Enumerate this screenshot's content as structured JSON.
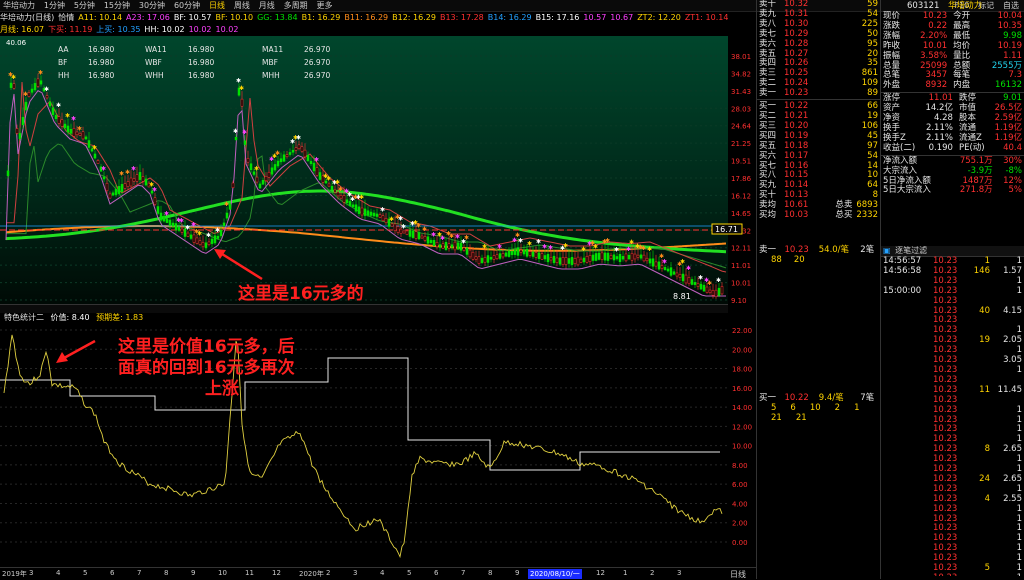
{
  "menu": {
    "items": [
      "华培动力",
      "1分钟",
      "5分钟",
      "15分钟",
      "30分钟",
      "60分钟",
      "日线",
      "周线",
      "月线",
      "多周期",
      "更多"
    ],
    "active": "日线",
    "right_items": [
      "F10",
      "标记",
      "自选"
    ]
  },
  "header_row1": [
    {
      "label": "华培动力(日线)",
      "color": "#e6e6e6"
    },
    {
      "label": "恰情",
      "color": "#e6e6e6"
    },
    {
      "label": "A11: 10.14",
      "color": "#ffd400"
    },
    {
      "label": "A23: 17.06",
      "color": "#ff40ff"
    },
    {
      "label": "BF: 10.57",
      "color": "#ffffff"
    },
    {
      "label": "BF: 10.10",
      "color": "#ffd400"
    },
    {
      "label": "GG: 13.84",
      "color": "#00e000"
    },
    {
      "label": "B1: 16.29",
      "color": "#ffd400"
    },
    {
      "label": "B11: 16.29",
      "color": "#ff8c1a"
    },
    {
      "label": "B12: 16.29",
      "color": "#ffd400"
    },
    {
      "label": "B13: 17.28",
      "color": "#ff3030"
    },
    {
      "label": "B14: 16.29",
      "color": "#22a0ff"
    },
    {
      "label": "B15: 17.16",
      "color": "#ffffff"
    },
    {
      "label": "10.57",
      "color": "#ff40ff"
    },
    {
      "label": "10.67",
      "color": "#ff40ff"
    },
    {
      "label": "ZT2: 12.20",
      "color": "#ffd400"
    },
    {
      "label": "ZT1: 10.14",
      "color": "#ff3030"
    }
  ],
  "header_row2": [
    {
      "label": "月线: 16.07",
      "color": "#ffd400"
    },
    {
      "label": "下买: 11.19",
      "color": "#ff3030"
    },
    {
      "label": "上买: 10.35",
      "color": "#22a0ff"
    },
    {
      "label": "HH: 10.02",
      "color": "#ffffff"
    },
    {
      "label": "10.02",
      "color": "#ff40ff"
    },
    {
      "label": "10.02",
      "color": "#ff40ff"
    }
  ],
  "legend_box": {
    "rows": [
      [
        {
          "k": "AA",
          "v": "16.980"
        },
        {
          "k": "WA11",
          "v": "16.980"
        },
        {
          "k": "MA11",
          "v": "26.970"
        }
      ],
      [
        {
          "k": "BF",
          "v": "16.980"
        },
        {
          "k": "WBF",
          "v": "16.980"
        },
        {
          "k": "MBF",
          "v": "26.970"
        }
      ],
      [
        {
          "k": "HH",
          "v": "16.980"
        },
        {
          "k": "WHH",
          "v": "16.980"
        },
        {
          "k": "MHH",
          "v": "26.970"
        }
      ]
    ]
  },
  "main_price_labels": [
    "38.01",
    "34.82",
    "31.43",
    "28.03",
    "24.64",
    "21.25",
    "19.51",
    "17.86",
    "16.12",
    "14.65",
    "13.32",
    "12.11",
    "11.01",
    "10.01",
    "9.10"
  ],
  "main_extra_labels": {
    "high": "40.06",
    "low": "8.81",
    "current": "16.71"
  },
  "ind_header": {
    "name": "特色统计二",
    "value_label": "价值: 8.40",
    "diff_label": "预期差: 1.83"
  },
  "ind_labels": [
    "22.00",
    "20.00",
    "18.00",
    "16.00",
    "14.00",
    "12.00",
    "10.00",
    "8.00",
    "6.00",
    "4.00",
    "2.00",
    "0.00"
  ],
  "annotations": {
    "a1": "这里是16元多的",
    "a2_line1": "这里是价值16元多，后",
    "a2_line2": "面真的回到16元多再次",
    "a2_line3": "上涨"
  },
  "bottom_axis": {
    "labels": [
      "2019年",
      "3",
      "4",
      "5",
      "6",
      "7",
      "8",
      "9",
      "10",
      "11",
      "12",
      "2020年",
      "2",
      "3",
      "4",
      "5",
      "6",
      "7",
      "8",
      "9",
      "10",
      "11",
      "12",
      "1",
      "2",
      "3"
    ],
    "date_box": "2020/08/10/一",
    "period": "日线"
  },
  "orderbook_sell": [
    {
      "name": "卖十",
      "price": "10.32",
      "vol": "59"
    },
    {
      "name": "卖九",
      "price": "10.31",
      "vol": "54"
    },
    {
      "name": "卖八",
      "price": "10.30",
      "vol": "225"
    },
    {
      "name": "卖七",
      "price": "10.29",
      "vol": "50"
    },
    {
      "name": "卖六",
      "price": "10.28",
      "vol": "95"
    },
    {
      "name": "卖五",
      "price": "10.27",
      "vol": "20"
    },
    {
      "name": "卖四",
      "price": "10.26",
      "vol": "35"
    },
    {
      "name": "卖三",
      "price": "10.25",
      "vol": "861"
    },
    {
      "name": "卖二",
      "price": "10.24",
      "vol": "109"
    },
    {
      "name": "卖一",
      "price": "10.23",
      "vol": "89"
    }
  ],
  "orderbook_buy": [
    {
      "name": "买一",
      "price": "10.22",
      "vol": "66"
    },
    {
      "name": "买二",
      "price": "10.21",
      "vol": "19"
    },
    {
      "name": "买三",
      "price": "10.20",
      "vol": "106"
    },
    {
      "name": "买四",
      "price": "10.19",
      "vol": "45"
    },
    {
      "name": "买五",
      "price": "10.18",
      "vol": "97"
    },
    {
      "name": "买六",
      "price": "10.17",
      "vol": "54"
    },
    {
      "name": "买七",
      "price": "10.16",
      "vol": "14"
    },
    {
      "name": "买八",
      "price": "10.15",
      "vol": "10"
    },
    {
      "name": "买九",
      "price": "10.14",
      "vol": "64"
    },
    {
      "name": "买十",
      "price": "10.13",
      "vol": "8"
    }
  ],
  "orderbook_summary": [
    {
      "name": "卖均",
      "price": "10.61",
      "k": "总卖",
      "v": "6893"
    },
    {
      "name": "买均",
      "price": "10.03",
      "k": "总买",
      "v": "2332"
    }
  ],
  "queue_sell": {
    "name": "卖一",
    "price": "10.23",
    "detail": "54.0/笔",
    "count": "2笔",
    "row2": [
      "88",
      "20"
    ]
  },
  "queue_buy": {
    "name": "买一",
    "price": "10.22",
    "detail": "9.4/笔",
    "count": "7笔",
    "row2": [
      "5",
      "6",
      "10",
      "2",
      "1"
    ],
    "row3": [
      "21",
      "21"
    ]
  },
  "stock": {
    "code": "603121",
    "name": "华培动力"
  },
  "stats": [
    {
      "k1": "现价",
      "v1": "10.23",
      "k2": "今开",
      "v2": "10.04"
    },
    {
      "k1": "涨跌",
      "v1": "0.22",
      "k2": "最高",
      "v2": "10.35"
    },
    {
      "k1": "涨幅",
      "v1": "2.20%",
      "k2": "最低",
      "v2": "9.98"
    },
    {
      "k1": "昨收",
      "v1": "10.01",
      "k2": "均价",
      "v2": "10.19"
    },
    {
      "k1": "振幅",
      "v1": "3.58%",
      "k2": "量比",
      "v2": "1.11"
    },
    {
      "k1": "总量",
      "v1": "25099",
      "k2": "总额",
      "v2": "2555万"
    },
    {
      "k1": "总笔",
      "v1": "3457",
      "k2": "每笔",
      "v2": "7.3"
    },
    {
      "k1": "外盘",
      "v1": "8932",
      "k2": "内盘",
      "v2": "16132"
    }
  ],
  "stats2": [
    {
      "k1": "涨停",
      "v1": "11.01",
      "k2": "跌停",
      "v2": "9.01"
    },
    {
      "k1": "资产",
      "v1": "14.2亿",
      "k2": "市值",
      "v2": "26.5亿"
    },
    {
      "k1": "净资",
      "v1": "4.28",
      "k2": "股本",
      "v2": "2.59亿"
    },
    {
      "k1": "换手",
      "v1": "2.11%",
      "k2": "流通",
      "v2": "1.19亿"
    },
    {
      "k1": "换手Z",
      "v1": "2.11%",
      "k2": "流通Z",
      "v2": "1.19亿"
    },
    {
      "k1": "收益(二)",
      "v1": "0.190",
      "k2": "PE(动)",
      "v2": "40.4"
    }
  ],
  "flows": [
    {
      "k": "净流入额",
      "v": "755.1万",
      "p": "30%"
    },
    {
      "k": "大宗流入",
      "v": "-3.9万",
      "p": "-8%"
    },
    {
      "k": "5日净流入额",
      "v": "1487万",
      "p": "12%"
    },
    {
      "k": "5日大宗流入",
      "v": "271.8万",
      "p": "5%"
    }
  ],
  "trades_header": "逐笔过滤",
  "trades": [
    {
      "t": "14:56:57",
      "p": "10.23",
      "v": "1",
      "n": "1"
    },
    {
      "t": "14:56:58",
      "p": "10.23",
      "v": "146",
      "n": "1.57"
    },
    {
      "t": "",
      "p": "10.23",
      "v": "",
      "n": "1"
    },
    {
      "t": "15:00:00",
      "p": "10.23",
      "v": "",
      "n": "1"
    },
    {
      "t": "",
      "p": "10.23",
      "v": "",
      "n": ""
    },
    {
      "t": "",
      "p": "10.23",
      "v": "40",
      "n": "4.15"
    },
    {
      "t": "",
      "p": "10.23",
      "v": "",
      "n": ""
    },
    {
      "t": "",
      "p": "10.23",
      "v": "",
      "n": "1"
    },
    {
      "t": "",
      "p": "10.23",
      "v": "19",
      "n": "2.05"
    },
    {
      "t": "",
      "p": "10.23",
      "v": "",
      "n": "1"
    },
    {
      "t": "",
      "p": "10.23",
      "v": "",
      "n": "3.05"
    },
    {
      "t": "",
      "p": "10.23",
      "v": "",
      "n": "1"
    },
    {
      "t": "",
      "p": "10.23",
      "v": "",
      "n": ""
    },
    {
      "t": "",
      "p": "10.23",
      "v": "11",
      "n": "11.45"
    },
    {
      "t": "",
      "p": "10.23",
      "v": "",
      "n": ""
    },
    {
      "t": "",
      "p": "10.23",
      "v": "",
      "n": "1"
    },
    {
      "t": "",
      "p": "10.23",
      "v": "",
      "n": "1"
    },
    {
      "t": "",
      "p": "10.23",
      "v": "",
      "n": "1"
    },
    {
      "t": "",
      "p": "10.23",
      "v": "",
      "n": "1"
    },
    {
      "t": "",
      "p": "10.23",
      "v": "8",
      "n": "2.65"
    },
    {
      "t": "",
      "p": "10.23",
      "v": "",
      "n": "1"
    },
    {
      "t": "",
      "p": "10.23",
      "v": "",
      "n": "1"
    },
    {
      "t": "",
      "p": "10.23",
      "v": "24",
      "n": "2.65"
    },
    {
      "t": "",
      "p": "10.23",
      "v": "",
      "n": "1"
    },
    {
      "t": "",
      "p": "10.23",
      "v": "4",
      "n": "2.55"
    },
    {
      "t": "",
      "p": "10.23",
      "v": "",
      "n": "1"
    },
    {
      "t": "",
      "p": "10.23",
      "v": "",
      "n": "1"
    },
    {
      "t": "",
      "p": "10.23",
      "v": "",
      "n": "1"
    },
    {
      "t": "",
      "p": "10.23",
      "v": "",
      "n": "1"
    },
    {
      "t": "",
      "p": "10.23",
      "v": "",
      "n": "1"
    },
    {
      "t": "",
      "p": "10.23",
      "v": "",
      "n": "1"
    },
    {
      "t": "",
      "p": "10.23",
      "v": "5",
      "n": "1"
    },
    {
      "t": "",
      "p": "10.23",
      "v": "",
      "n": "1"
    }
  ],
  "colors": {
    "up": "#ff3030",
    "down": "#00e000",
    "accent": "#ffd400",
    "bg": "#000000"
  }
}
